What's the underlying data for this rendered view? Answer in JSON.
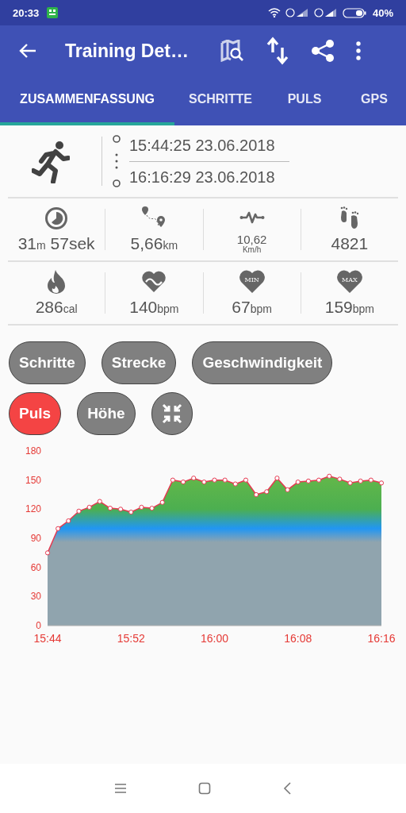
{
  "status_bar": {
    "time": "20:33",
    "battery": "40%"
  },
  "app_bar": {
    "title": "Training Det…"
  },
  "tabs": [
    {
      "label": "ZUSAMMENFASSUNG",
      "selected": true
    },
    {
      "label": "SCHRITTE",
      "selected": false
    },
    {
      "label": "PULS",
      "selected": false
    },
    {
      "label": "GPS",
      "selected": false
    }
  ],
  "session": {
    "start": "15:44:25 23.06.2018",
    "end": "16:16:29 23.06.2018"
  },
  "stats": [
    {
      "kind": "inline",
      "parts": [
        {
          "text": "31",
          "kind": "num"
        },
        {
          "text": "m",
          "kind": "unit"
        },
        {
          "text": " 57sek",
          "kind": "num"
        }
      ]
    },
    {
      "kind": "inline",
      "parts": [
        {
          "text": "5,66",
          "kind": "num"
        },
        {
          "text": "km",
          "kind": "unit"
        }
      ]
    },
    {
      "kind": "stacked",
      "parts": [
        {
          "text": "10,62",
          "kind": "num"
        },
        {
          "text": "Km/h",
          "kind": "unit"
        }
      ]
    },
    {
      "kind": "inline",
      "parts": [
        {
          "text": "4821",
          "kind": "num"
        }
      ]
    },
    {
      "kind": "inline",
      "parts": [
        {
          "text": "286",
          "kind": "num"
        },
        {
          "text": "cal",
          "kind": "unit"
        }
      ]
    },
    {
      "kind": "inline",
      "parts": [
        {
          "text": "140",
          "kind": "num"
        },
        {
          "text": "bpm",
          "kind": "unit"
        }
      ]
    },
    {
      "kind": "inline",
      "badge": "MIN",
      "parts": [
        {
          "text": "67",
          "kind": "num"
        },
        {
          "text": "bpm",
          "kind": "unit"
        }
      ]
    },
    {
      "kind": "inline",
      "badge": "MAX",
      "parts": [
        {
          "text": "159",
          "kind": "num"
        },
        {
          "text": "bpm",
          "kind": "unit"
        }
      ]
    }
  ],
  "chips": [
    {
      "label": "Schritte",
      "selected": false
    },
    {
      "label": "Strecke",
      "selected": false
    },
    {
      "label": "Geschwindigkeit",
      "selected": false
    },
    {
      "label": "Puls",
      "selected": true
    },
    {
      "label": "Höhe",
      "selected": false
    }
  ],
  "chart": {
    "chart_data": {
      "type": "area",
      "categories": [
        "15:44",
        null,
        null,
        null,
        null,
        null,
        null,
        null,
        "15:52",
        null,
        null,
        null,
        null,
        null,
        null,
        null,
        "16:00",
        null,
        null,
        null,
        null,
        null,
        null,
        null,
        "16:08",
        null,
        null,
        null,
        null,
        null,
        null,
        null,
        "16:16"
      ],
      "series": [
        {
          "color": "#e53950",
          "values": [
            75,
            100,
            108,
            118,
            122,
            128,
            121,
            120,
            117,
            122,
            121,
            127,
            150,
            148,
            152,
            148,
            150,
            150,
            146,
            150,
            135,
            138,
            152,
            140,
            148,
            149,
            150,
            154,
            151,
            147,
            149,
            150,
            147
          ]
        }
      ],
      "ylim": [
        0,
        180
      ],
      "yticks": [
        0,
        30,
        60,
        90,
        120,
        150,
        180
      ]
    }
  }
}
